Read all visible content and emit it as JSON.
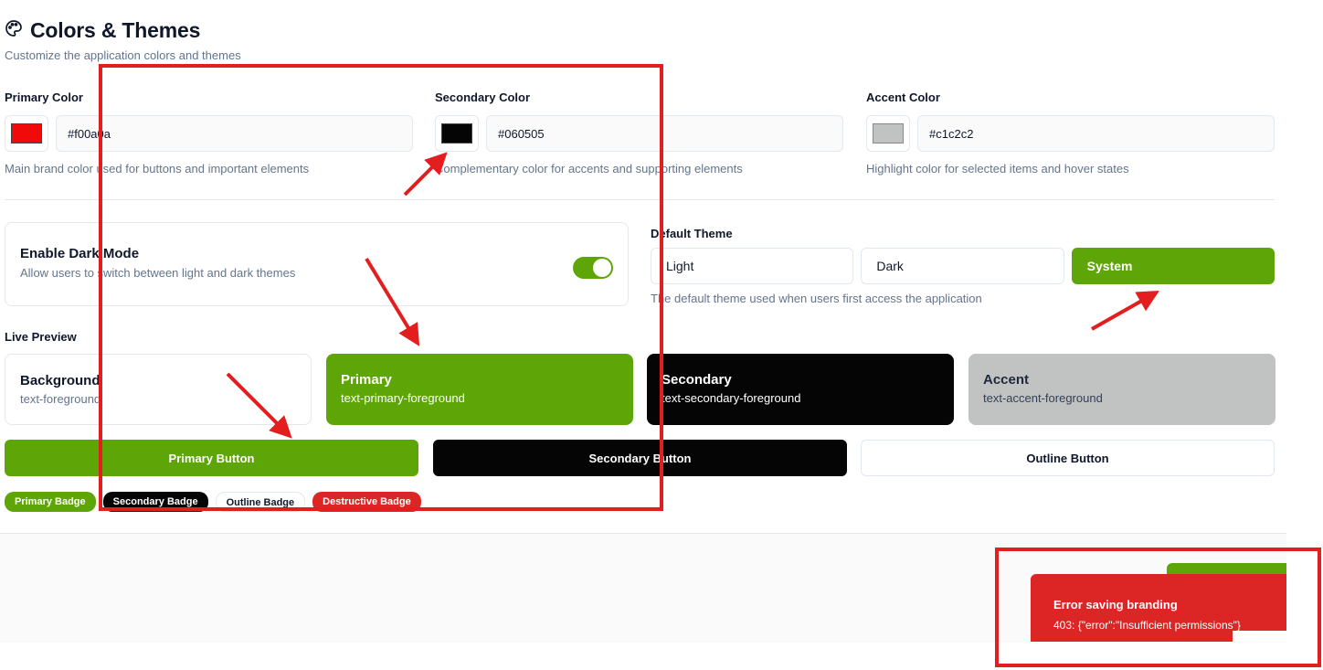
{
  "header": {
    "title": "Colors & Themes",
    "subtitle": "Customize the application colors and themes"
  },
  "colors": [
    {
      "label": "Primary Color",
      "value": "#f00a0a",
      "help": "Main brand color used for buttons and important elements",
      "swatch": "#f00a0a"
    },
    {
      "label": "Secondary Color",
      "value": "#060505",
      "help": "Complementary color for accents and supporting elements",
      "swatch": "#060505"
    },
    {
      "label": "Accent Color",
      "value": "#c1c2c2",
      "help": "Highlight color for selected items and hover states",
      "swatch": "#c1c2c2"
    }
  ],
  "dark_mode": {
    "title": "Enable Dark Mode",
    "description": "Allow users to switch between light and dark themes",
    "enabled": true
  },
  "theme": {
    "label": "Default Theme",
    "options": [
      "Light",
      "Dark",
      "System"
    ],
    "selected": "System",
    "help": "The default theme used when users first access the application"
  },
  "preview": {
    "label": "Live Preview",
    "cards": [
      {
        "title": "Background",
        "sub": "text-foreground"
      },
      {
        "title": "Primary",
        "sub": "text-primary-foreground"
      },
      {
        "title": "Secondary",
        "sub": "text-secondary-foreground"
      },
      {
        "title": "Accent",
        "sub": "text-accent-foreground"
      }
    ],
    "buttons": {
      "primary": "Primary Button",
      "secondary": "Secondary Button",
      "outline": "Outline Button"
    },
    "badges": {
      "primary": "Primary Badge",
      "secondary": "Secondary Badge",
      "outline": "Outline Badge",
      "destructive": "Destructive Badge"
    }
  },
  "toast": {
    "title": "Error saving branding",
    "message": "403: {\"error\":\"Insufficient permissions\"}"
  },
  "palette": {
    "primary_rendered": "#5ea508",
    "secondary_rendered": "#060505",
    "accent_rendered": "#c1c2c2",
    "destructive": "#dc2626",
    "annotation": "#e21e1e"
  },
  "icons": {
    "title_icon": "palette-icon"
  }
}
